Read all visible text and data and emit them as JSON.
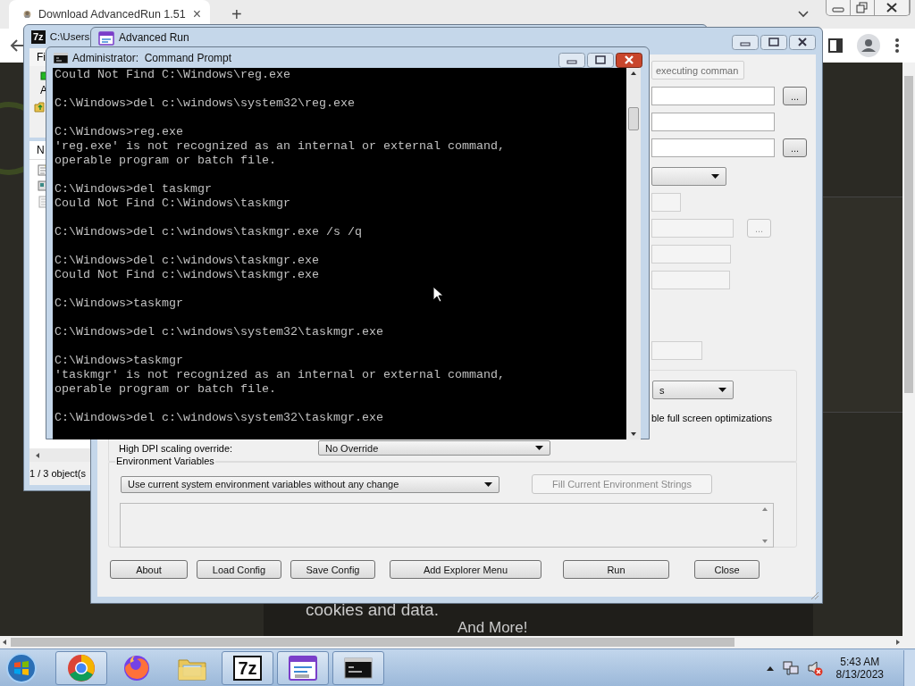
{
  "browser": {
    "tab": {
      "title": "Download AdvancedRun 1.51",
      "close": "×",
      "selected": true
    },
    "new_tab": "+",
    "page_texts": [
      "cookies and data.",
      "And More!"
    ]
  },
  "archive_window": {
    "logo_text": "7z",
    "title": "C:\\Users",
    "menu": [
      "Fi"
    ],
    "toolbar_label": "A",
    "column": "N",
    "status": "1 / 3 object(s"
  },
  "advanced_run": {
    "title": "Advanced Run",
    "rows": [
      {
        "kind": "combo",
        "value": "executing comman",
        "disabled": true
      },
      {
        "kind": "field",
        "browse": "...",
        "disabled": false
      },
      {
        "kind": "field",
        "disabled": false
      },
      {
        "kind": "field",
        "browse": "...",
        "disabled": false
      },
      {
        "kind": "select",
        "disabled": false
      },
      {
        "kind": "field",
        "disabled": true
      },
      {
        "kind": "field",
        "browse": "...",
        "disabled": true
      },
      {
        "kind": "field",
        "disabled": true
      },
      {
        "kind": "field",
        "disabled": true
      },
      {
        "kind": "field",
        "disabled": true
      }
    ],
    "compat": {
      "select": "s",
      "checkbox_label": "ble full screen optimizations",
      "dpi_label": "High DPI scaling override:",
      "dpi_value": "No Override"
    },
    "environment": {
      "title": "Environment Variables",
      "mode": "Use current system environment variables without any change",
      "fill_button": {
        "label": "Fill Current Environment Strings",
        "disabled": true
      }
    },
    "buttons": [
      "About",
      "Load Config",
      "Save Config",
      "Add Explorer Menu",
      "Run",
      "Close"
    ]
  },
  "command_prompt": {
    "title": "Administrator:  Command Prompt",
    "blocks": [
      [
        "Could Not Find C:\\Windows\\reg.exe"
      ],
      [
        "C:\\Windows>del c:\\windows\\system32\\reg.exe"
      ],
      [
        "C:\\Windows>reg.exe",
        "'reg.exe' is not recognized as an internal or external command,",
        "operable program or batch file."
      ],
      [
        "C:\\Windows>del taskmgr",
        "Could Not Find C:\\Windows\\taskmgr"
      ],
      [
        "C:\\Windows>del c:\\windows\\taskmgr.exe /s /q"
      ],
      [
        "C:\\Windows>del c:\\windows\\taskmgr.exe",
        "Could Not Find c:\\windows\\taskmgr.exe"
      ],
      [
        "C:\\Windows>taskmgr"
      ],
      [
        "C:\\Windows>del c:\\windows\\system32\\taskmgr.exe"
      ],
      [
        "C:\\Windows>taskmgr",
        "'taskmgr' is not recognized as an internal or external command,",
        "operable program or batch file."
      ],
      [
        "C:\\Windows>del c:\\windows\\system32\\taskmgr.exe"
      ]
    ]
  },
  "taskbar": {
    "apps": [
      {
        "kind": "chrome",
        "running": true
      },
      {
        "kind": "firefox",
        "running": false
      },
      {
        "kind": "folder",
        "running": false
      },
      {
        "kind": "archiver",
        "logo_text": "7z",
        "running": true
      },
      {
        "kind": "app",
        "running": true
      },
      {
        "kind": "console",
        "running": true
      }
    ],
    "clock": {
      "time": "5:43 AM",
      "date": "8/13/2023"
    }
  }
}
